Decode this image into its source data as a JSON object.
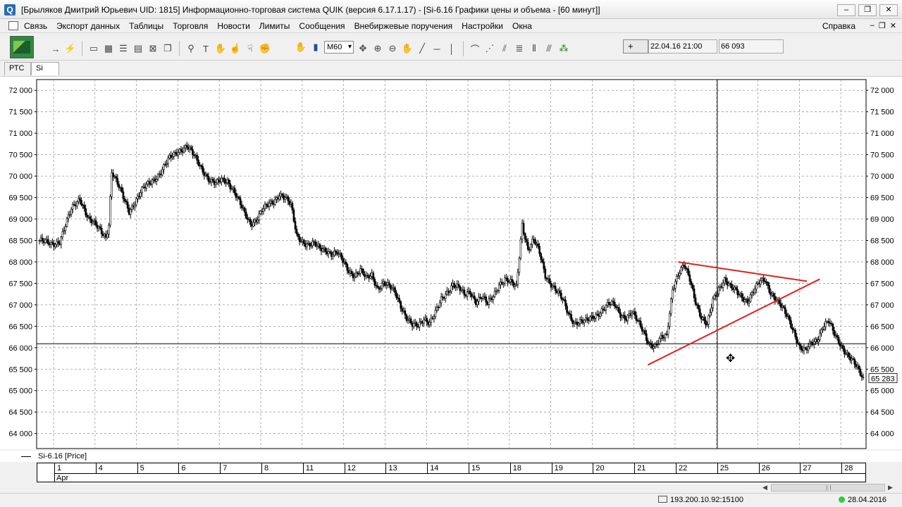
{
  "window": {
    "title": "[Брыляков Дмитрий Юрьевич UID: 1815] Информационно-торговая система QUIK (версия 6.17.1.17) - [Si-6.16 Графики цены и объема - [60 минут]]",
    "app_icon": "Q",
    "minimize": "–",
    "maximize": "❐",
    "close": "✕"
  },
  "menu": {
    "items": [
      "Связь",
      "Экспорт данных",
      "Таблицы",
      "Торговля",
      "Новости",
      "Лимиты",
      "Сообщения",
      "Внебиржевые поручения",
      "Настройки",
      "Окна"
    ],
    "help": "Справка",
    "mdi_min": "–",
    "mdi_restore": "❐",
    "mdi_close": "✕"
  },
  "toolbar": {
    "interval": "M60",
    "cross_symbol": "+",
    "datetime": "22.04.16 21:00",
    "price": "66 093"
  },
  "tabs": [
    {
      "label": "РТС",
      "active": false
    },
    {
      "label": "Si",
      "active": true
    }
  ],
  "chart_data": {
    "type": "candlestick",
    "instrument": "Si-6.16 [Price]",
    "ylim": [
      63650,
      72250
    ],
    "y_ticks": [
      "64 000",
      "64 500",
      "65 000",
      "65 500",
      "66 000",
      "66 500",
      "67 000",
      "67 500",
      "68 000",
      "68 500",
      "69 000",
      "69 500",
      "70 000",
      "70 500",
      "71 000",
      "71 500",
      "72 000"
    ],
    "y_tick_values": [
      64000,
      64500,
      65000,
      65500,
      66000,
      66500,
      67000,
      67500,
      68000,
      68500,
      69000,
      69500,
      70000,
      70500,
      71000,
      71500,
      72000
    ],
    "x_days": [
      "1",
      "4",
      "5",
      "6",
      "7",
      "8",
      "11",
      "12",
      "13",
      "14",
      "15",
      "18",
      "19",
      "20",
      "21",
      "22",
      "25",
      "26",
      "27",
      "28"
    ],
    "x_month": "Apr",
    "close_path": [
      [
        0,
        68500
      ],
      [
        8,
        68400
      ],
      [
        14,
        68500
      ],
      [
        22,
        69200
      ],
      [
        28,
        69500
      ],
      [
        34,
        69000
      ],
      [
        40,
        68800
      ],
      [
        46,
        68600
      ],
      [
        48,
        68900
      ],
      [
        50,
        70100
      ],
      [
        54,
        69800
      ],
      [
        58,
        69500
      ],
      [
        62,
        69200
      ],
      [
        66,
        69400
      ],
      [
        72,
        69700
      ],
      [
        78,
        69900
      ],
      [
        84,
        70100
      ],
      [
        90,
        70400
      ],
      [
        96,
        70600
      ],
      [
        102,
        70700
      ],
      [
        106,
        70500
      ],
      [
        110,
        70300
      ],
      [
        114,
        70100
      ],
      [
        118,
        69900
      ],
      [
        122,
        69800
      ],
      [
        126,
        69900
      ],
      [
        130,
        69900
      ],
      [
        134,
        69700
      ],
      [
        138,
        69400
      ],
      [
        142,
        69100
      ],
      [
        146,
        68900
      ],
      [
        150,
        69000
      ],
      [
        154,
        69200
      ],
      [
        158,
        69300
      ],
      [
        162,
        69400
      ],
      [
        166,
        69600
      ],
      [
        170,
        69500
      ],
      [
        174,
        69300
      ],
      [
        178,
        68600
      ],
      [
        182,
        68500
      ],
      [
        186,
        68400
      ],
      [
        190,
        68400
      ],
      [
        194,
        68300
      ],
      [
        198,
        68300
      ],
      [
        202,
        68200
      ],
      [
        206,
        68200
      ],
      [
        210,
        68000
      ],
      [
        214,
        67800
      ],
      [
        218,
        67700
      ],
      [
        222,
        67800
      ],
      [
        226,
        67600
      ],
      [
        230,
        67700
      ],
      [
        234,
        67400
      ],
      [
        238,
        67500
      ],
      [
        242,
        67400
      ],
      [
        246,
        67300
      ],
      [
        250,
        67000
      ],
      [
        254,
        66700
      ],
      [
        258,
        66500
      ],
      [
        262,
        66500
      ],
      [
        266,
        66700
      ],
      [
        270,
        66600
      ],
      [
        274,
        66800
      ],
      [
        278,
        67100
      ],
      [
        282,
        67300
      ],
      [
        286,
        67500
      ],
      [
        290,
        67400
      ],
      [
        294,
        67200
      ],
      [
        298,
        67300
      ],
      [
        302,
        67100
      ],
      [
        306,
        67200
      ],
      [
        310,
        67000
      ],
      [
        314,
        67200
      ],
      [
        318,
        67500
      ],
      [
        322,
        67600
      ],
      [
        326,
        67500
      ],
      [
        330,
        67400
      ],
      [
        334,
        68900
      ],
      [
        338,
        68300
      ],
      [
        342,
        68500
      ],
      [
        346,
        68200
      ],
      [
        350,
        67700
      ],
      [
        354,
        67500
      ],
      [
        358,
        67300
      ],
      [
        362,
        67100
      ],
      [
        366,
        66800
      ],
      [
        370,
        66600
      ],
      [
        374,
        66600
      ],
      [
        378,
        66600
      ],
      [
        382,
        66700
      ],
      [
        386,
        66800
      ],
      [
        390,
        66900
      ],
      [
        394,
        67000
      ],
      [
        398,
        67000
      ],
      [
        402,
        66800
      ],
      [
        406,
        66700
      ],
      [
        410,
        66800
      ],
      [
        414,
        66600
      ],
      [
        418,
        66400
      ],
      [
        422,
        66100
      ],
      [
        426,
        66000
      ],
      [
        430,
        66200
      ],
      [
        434,
        66300
      ],
      [
        438,
        67400
      ],
      [
        442,
        67700
      ],
      [
        446,
        67900
      ],
      [
        450,
        67600
      ],
      [
        454,
        67100
      ],
      [
        458,
        66700
      ],
      [
        462,
        66500
      ],
      [
        466,
        67100
      ],
      [
        470,
        67400
      ],
      [
        474,
        67600
      ],
      [
        478,
        67400
      ],
      [
        482,
        67300
      ],
      [
        486,
        67200
      ],
      [
        490,
        67100
      ],
      [
        494,
        67300
      ],
      [
        498,
        67500
      ],
      [
        502,
        67600
      ],
      [
        506,
        67300
      ],
      [
        510,
        67100
      ],
      [
        514,
        66900
      ],
      [
        518,
        66700
      ],
      [
        522,
        66400
      ],
      [
        526,
        66000
      ],
      [
        530,
        65900
      ],
      [
        534,
        66100
      ],
      [
        538,
        66200
      ],
      [
        542,
        66500
      ],
      [
        546,
        66600
      ],
      [
        550,
        66300
      ],
      [
        554,
        66100
      ],
      [
        558,
        65900
      ],
      [
        562,
        65700
      ],
      [
        566,
        65500
      ],
      [
        570,
        65283
      ]
    ],
    "trendlines": [
      {
        "from": [
          421,
          65600
        ],
        "to": [
          540,
          67600
        ],
        "color": "#e02020"
      },
      {
        "from": [
          442,
          68000
        ],
        "to": [
          531,
          67550
        ],
        "color": "#e02020"
      }
    ],
    "crosshair": {
      "x": 469,
      "y": 66093
    },
    "last_price": "65 283",
    "candle_color": "#000000",
    "grid": true
  },
  "status": {
    "server": "193.200.10.92:15100",
    "date": "28.04.2016",
    "connection_color": "#2ecc40"
  }
}
